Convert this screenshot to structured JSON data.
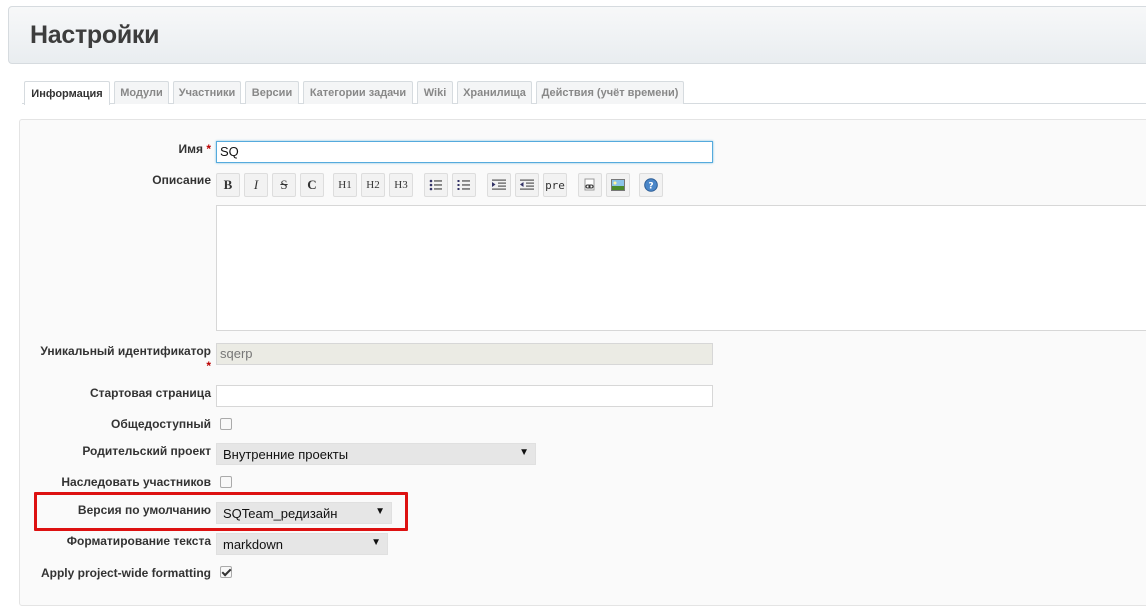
{
  "header": {
    "title": "Настройки"
  },
  "tabs": [
    {
      "label": "Информация",
      "active": true
    },
    {
      "label": "Модули"
    },
    {
      "label": "Участники"
    },
    {
      "label": "Версии"
    },
    {
      "label": "Категории задачи"
    },
    {
      "label": "Wiki"
    },
    {
      "label": "Хранилища"
    },
    {
      "label": "Действия (учёт времени)"
    }
  ],
  "form": {
    "name": {
      "label": "Имя",
      "required": "*",
      "value": "SQ"
    },
    "description": {
      "label": "Описание",
      "toolbar": [
        "bold-icon",
        "italic-icon",
        "strikethrough-icon",
        "code-icon",
        "H1",
        "H2",
        "H3",
        "unordered-list-icon",
        "ordered-list-icon",
        "indent-icon",
        "outdent-icon",
        "pre",
        "link-icon",
        "image-icon",
        "help-icon"
      ],
      "toolbar_text": {
        "bold": "B",
        "italic": "I",
        "strike": "S",
        "code": "C",
        "h1": "H1",
        "h2": "H2",
        "h3": "H3",
        "pre": "pre"
      },
      "value": ""
    },
    "identifier": {
      "label": "Уникальный идентификатор",
      "required": "*",
      "value": "sqerp"
    },
    "homepage": {
      "label": "Стартовая страница",
      "value": ""
    },
    "is_public": {
      "label": "Общедоступный",
      "checked": false
    },
    "parent": {
      "label": "Родительский проект",
      "value": "Внутренние проекты"
    },
    "inherit_members": {
      "label": "Наследовать участников",
      "checked": false
    },
    "default_version": {
      "label": "Версия по умолчанию",
      "value": "SQTeam_редизайн"
    },
    "text_formatting": {
      "label": "Форматирование текста",
      "value": "markdown"
    },
    "apply_formatting": {
      "label": "Apply project-wide formatting",
      "checked": true
    }
  },
  "colors": {
    "highlight": "#dd1111",
    "required": "#bb0000",
    "focus_border": "#55aadd"
  }
}
